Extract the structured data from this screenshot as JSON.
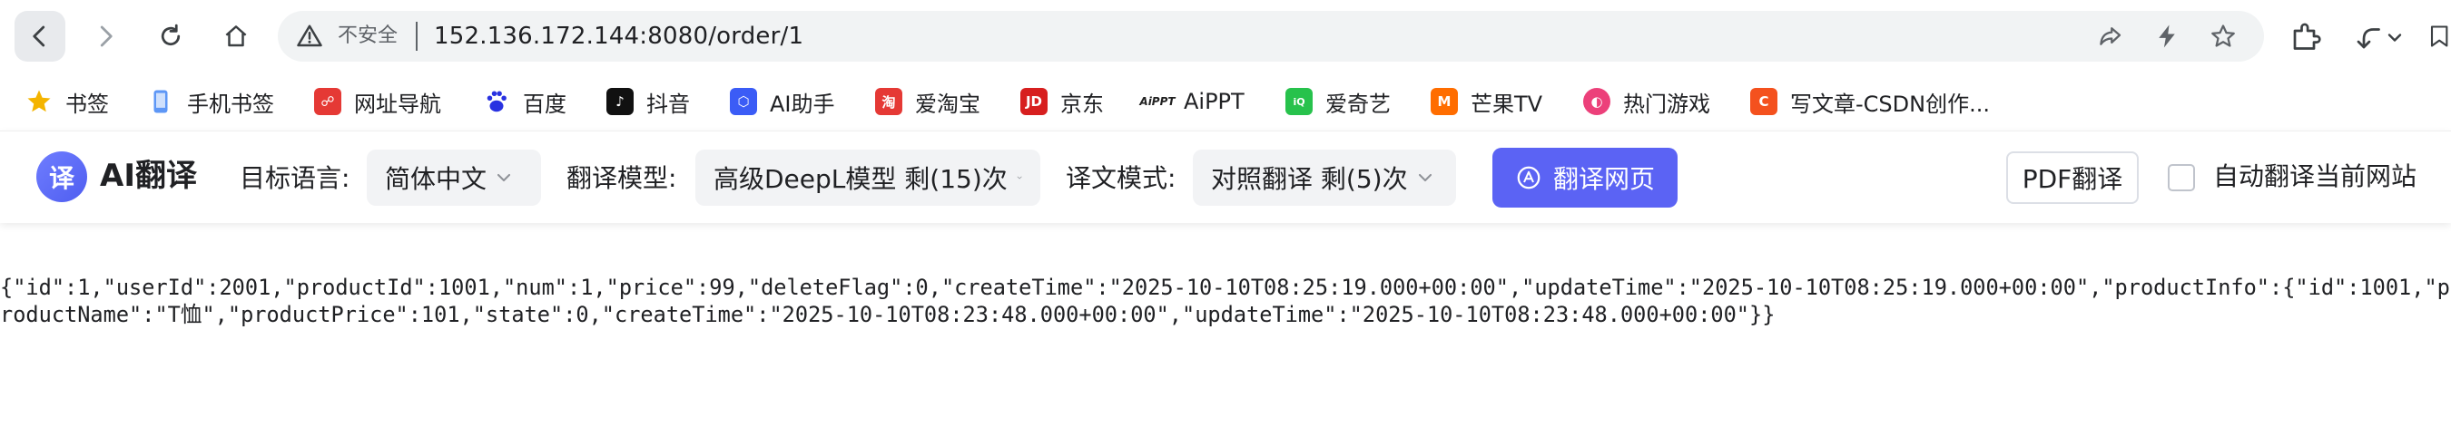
{
  "browser": {
    "address_bar": {
      "security_label": "不安全",
      "url": "152.136.172.144:8080/order/1"
    },
    "icons": {
      "back": "back-arrow-icon",
      "forward": "forward-arrow-icon",
      "reload": "reload-icon",
      "home": "home-icon",
      "warning": "warning-icon",
      "share": "share-icon",
      "bolt": "lightning-icon",
      "star": "star-icon",
      "extensions": "extensions-icon",
      "undo": "undo-icon"
    }
  },
  "bookmarks": [
    {
      "label": "书签",
      "icon": "star-icon",
      "color": "#f4b400"
    },
    {
      "label": "手机书签",
      "icon": "phone-icon",
      "color": "#4285f4"
    },
    {
      "label": "网址导航",
      "icon": "nav-icon",
      "color": "#e53935"
    },
    {
      "label": "百度",
      "icon": "baidu-icon",
      "color": "#2932e1"
    },
    {
      "label": "抖音",
      "icon": "douyin-icon",
      "color": "#111111"
    },
    {
      "label": "AI助手",
      "icon": "ai-assistant-icon",
      "color": "#3b5cf6"
    },
    {
      "label": "爱淘宝",
      "icon": "taobao-icon",
      "color": "#e53935"
    },
    {
      "label": "京东",
      "icon": "jd-icon",
      "color": "#d71f1f"
    },
    {
      "label": "AiPPT",
      "icon": "aippt-icon",
      "color": "#222222"
    },
    {
      "label": "爱奇艺",
      "icon": "iqiyi-icon",
      "color": "#27c24c"
    },
    {
      "label": "芒果TV",
      "icon": "mango-icon",
      "color": "#ff6d00"
    },
    {
      "label": "热门游戏",
      "icon": "game-icon",
      "color": "#ec407a"
    },
    {
      "label": "写文章-CSDN创作...",
      "icon": "csdn-icon",
      "color": "#f4511e"
    }
  ],
  "translator": {
    "brand": "AI翻译",
    "logo_char": "译",
    "target_lang_label": "目标语言:",
    "target_lang_value": "简体中文",
    "model_label": "翻译模型:",
    "model_value": "高级DeepL模型 剩(15)次",
    "mode_label": "译文模式:",
    "mode_value": "对照翻译 剩(5)次",
    "translate_button": "翻译网页",
    "pdf_button": "PDF翻译",
    "auto_translate_label": "自动翻译当前网站",
    "auto_translate_checked": false,
    "accent_color": "#5b63f4"
  },
  "page": {
    "body_text": "{\"id\":1,\"userId\":2001,\"productId\":1001,\"num\":1,\"price\":99,\"deleteFlag\":0,\"createTime\":\"2025-10-10T08:25:19.000+00:00\",\"updateTime\":\"2025-10-10T08:25:19.000+00:00\",\"productInfo\":{\"id\":1001,\"productName\":\"T恤\",\"productPrice\":101,\"state\":0,\"createTime\":\"2025-10-10T08:23:48.000+00:00\",\"updateTime\":\"2025-10-10T08:23:48.000+00:00\"}}"
  }
}
